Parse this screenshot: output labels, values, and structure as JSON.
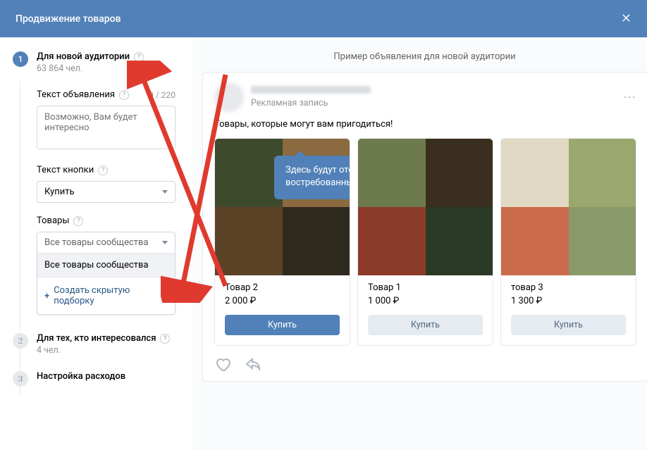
{
  "header": {
    "title": "Продвижение товаров"
  },
  "steps": {
    "s1": {
      "num": "1",
      "title": "Для новой аудитории",
      "sub": "63 864 чел."
    },
    "s2": {
      "num": "2",
      "title": "Для тех, кто интересовался",
      "sub": "4 чел."
    },
    "s3": {
      "num": "3",
      "title": "Настройка расходов"
    }
  },
  "ad_text": {
    "label": "Текст объявления",
    "counter": "0 / 220",
    "placeholder": "Возможно, Вам будет интересно"
  },
  "button_text": {
    "label": "Текст кнопки",
    "selected": "Купить"
  },
  "goods": {
    "label": "Товары",
    "selected": "Все товары сообщества",
    "option": "Все товары сообщества",
    "create": "Создать скрытую подборку"
  },
  "preview": {
    "title": "Пример объявления для новой аудитории",
    "ad_label": "Рекламная запись",
    "lead": "Товары, которые могут вам пригодиться!",
    "tooltip": "Здесь будут отображаться самые востребованные и интересные товары",
    "products": [
      {
        "name": "Товар 2",
        "price": "2 000 ₽",
        "primary": true
      },
      {
        "name": "Товар 1",
        "price": "1 000 ₽",
        "primary": false
      },
      {
        "name": "товар 3",
        "price": "1 300 ₽",
        "primary": false
      }
    ],
    "buy": "Купить"
  }
}
